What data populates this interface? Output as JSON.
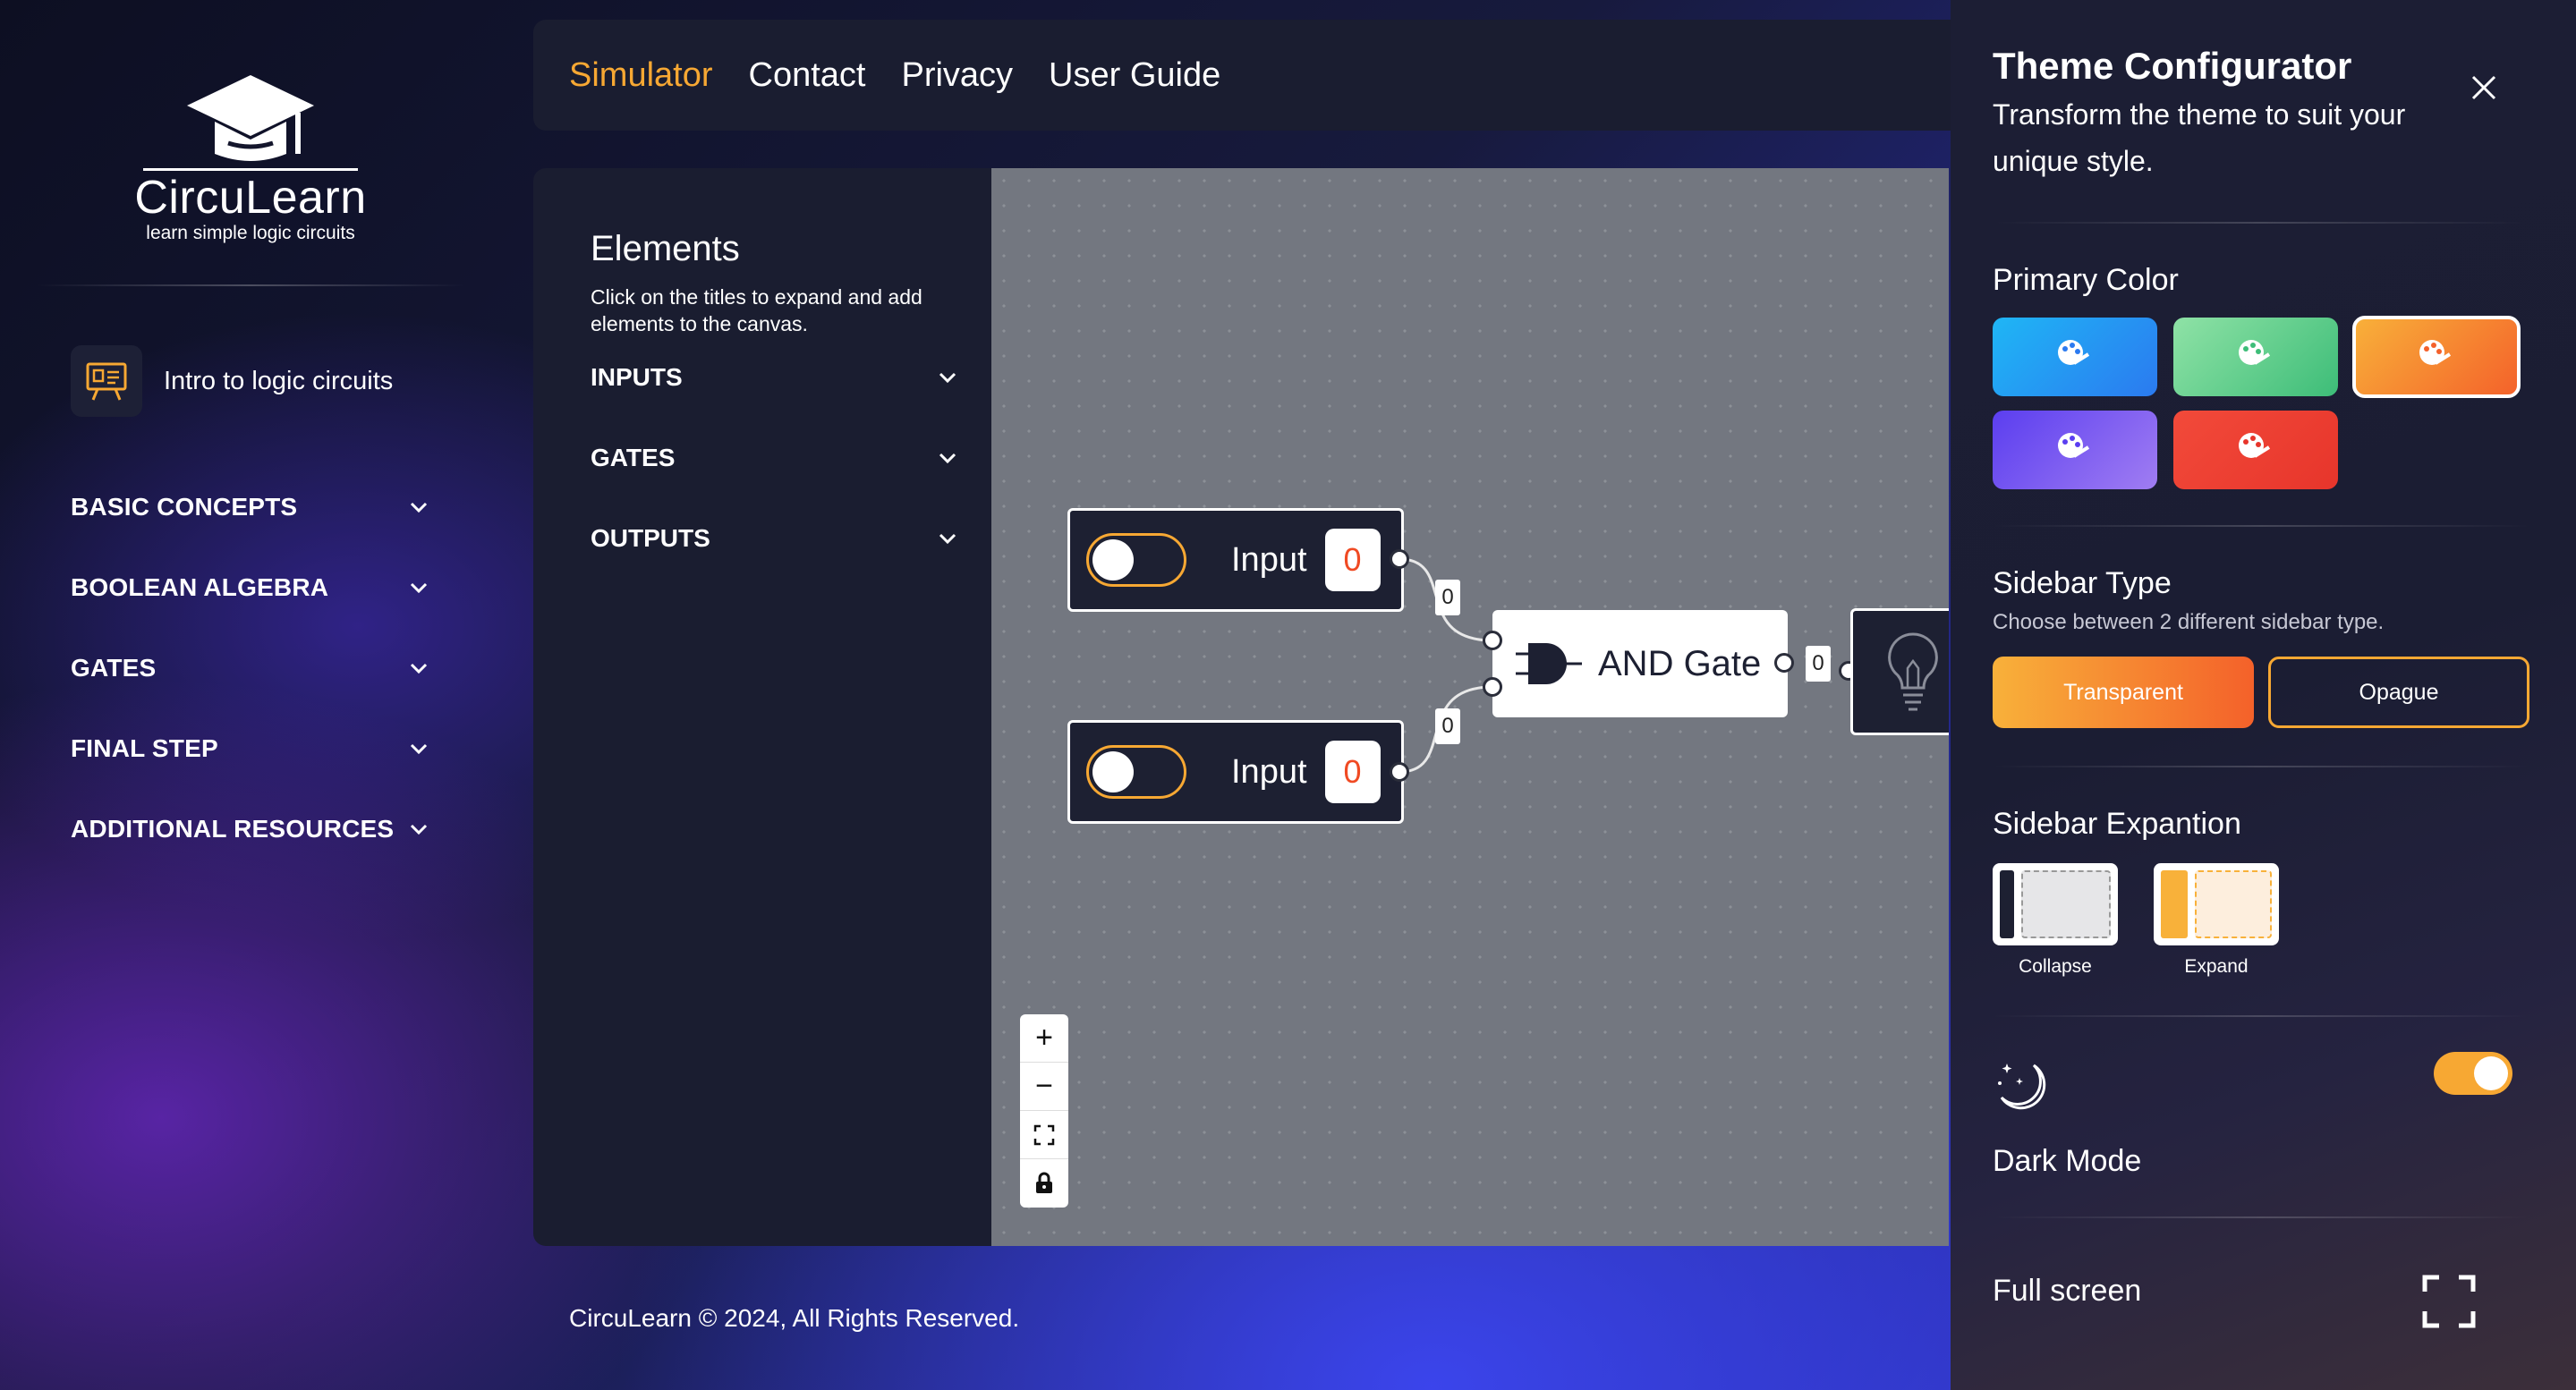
{
  "brand": {
    "name": "CircuLearn",
    "tagline": "learn simple logic circuits"
  },
  "sidebar": {
    "intro_label": "Intro to logic circuits",
    "items": [
      {
        "label": "BASIC CONCEPTS"
      },
      {
        "label": "BOOLEAN ALGEBRA"
      },
      {
        "label": "GATES"
      },
      {
        "label": "FINAL STEP"
      },
      {
        "label": "ADDITIONAL RESOURCES"
      }
    ]
  },
  "header": {
    "links": [
      {
        "label": "Simulator",
        "active": true
      },
      {
        "label": "Contact"
      },
      {
        "label": "Privacy"
      },
      {
        "label": "User Guide"
      }
    ]
  },
  "elements_panel": {
    "title": "Elements",
    "subtitle": "Click on the titles to expand and add elements to the canvas.",
    "sections": [
      {
        "label": "INPUTS"
      },
      {
        "label": "GATES"
      },
      {
        "label": "OUTPUTS"
      }
    ]
  },
  "canvas": {
    "input1": {
      "label": "Input",
      "value": "0"
    },
    "input2": {
      "label": "Input",
      "value": "0"
    },
    "gate": {
      "label": "AND Gate"
    },
    "wire_in1": "0",
    "wire_in2": "0",
    "wire_out": "0",
    "zoom_controls": {
      "zoom_in": "+",
      "zoom_out": "−"
    }
  },
  "footer": {
    "text": "CircuLearn © 2024, All Rights Reserved."
  },
  "theme_config": {
    "title": "Theme Configurator",
    "subtitle": "Transform the theme to suit your unique style.",
    "primary_color": {
      "title": "Primary Color",
      "swatches": [
        {
          "gradient": [
            "#1fb6f5",
            "#2b7af0"
          ]
        },
        {
          "gradient": [
            "#8fe2a6",
            "#3dbd78"
          ]
        },
        {
          "gradient": [
            "#f8b13a",
            "#f4612a"
          ],
          "selected": true
        },
        {
          "gradient": [
            "#5b3ef0",
            "#a07df2"
          ]
        },
        {
          "gradient": [
            "#f24a3a",
            "#e7352b"
          ]
        }
      ]
    },
    "sidebar_type": {
      "title": "Sidebar Type",
      "subtitle": "Choose between 2 different sidebar type.",
      "options": [
        "Transparent",
        "Opague"
      ]
    },
    "sidebar_expansion": {
      "title": "Sidebar Expantion",
      "options": [
        "Collapse",
        "Expand"
      ]
    },
    "dark_mode": {
      "label": "Dark Mode",
      "enabled": true
    },
    "full_screen": {
      "label": "Full screen"
    }
  },
  "colors": {
    "accent": "#f7a833",
    "panel": "#1a1d30",
    "canvas": "#737780",
    "value_red": "#f04a23"
  }
}
